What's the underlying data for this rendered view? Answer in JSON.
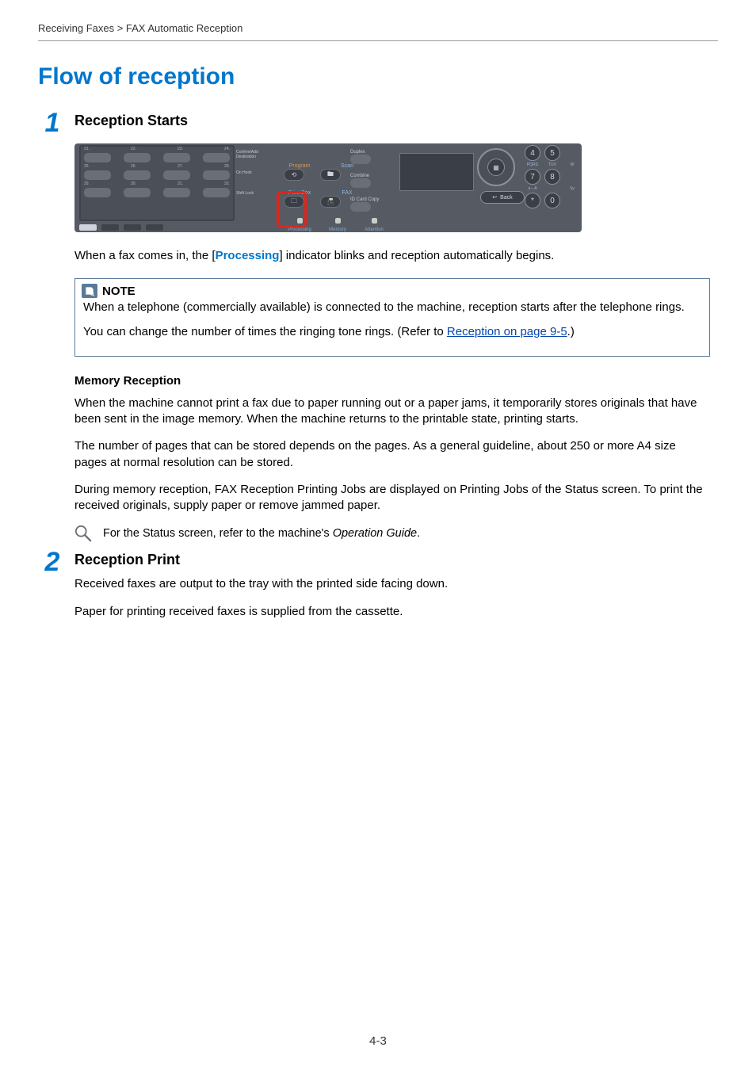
{
  "breadcrumb": "Receiving Faxes > FAX Automatic Reception",
  "heading": "Flow of reception",
  "step1": {
    "num": "1",
    "title": "Reception Starts",
    "intro_pre": "When a fax comes in, the [",
    "intro_proc": "Processing",
    "intro_post": "] indicator blinks and reception automatically begins.",
    "note_label": "NOTE",
    "note_p1": "When a telephone (commercially available) is connected to the machine, reception starts after the telephone rings.",
    "note_p2_pre": "You can change the number of times the ringing tone rings. (Refer to ",
    "note_p2_link": "Reception on page 9-5",
    "note_p2_post": ".)",
    "mem_heading": "Memory Reception",
    "mem_p1": "When the machine cannot print a fax due to paper running out or a paper jams, it temporarily stores originals that have been sent in the image memory. When the machine returns to the printable state, printing starts.",
    "mem_p2": "The number of pages that can be stored depends on the pages. As a general guideline, about 250 or more A4 size pages at normal resolution can be stored.",
    "mem_p3": "During memory reception, FAX Reception Printing Jobs are displayed on Printing Jobs of the Status screen. To print the received originals, supply paper or remove jammed paper.",
    "ref_pre": "For the Status screen, refer to the machine's ",
    "ref_ital": "Operation Guide",
    "ref_post": "."
  },
  "step2": {
    "num": "2",
    "title": "Reception Print",
    "p1": "Received faxes are output to the tray with the printed side facing down.",
    "p2": "Paper for printing received faxes is supplied from the cassette."
  },
  "panel": {
    "keys_row1": [
      "21.",
      "22.",
      "23.",
      "24."
    ],
    "keys_row2": [
      "25.",
      "26.",
      "27.",
      "28."
    ],
    "keys_row3": [
      "29.",
      "30.",
      "31.",
      "32."
    ],
    "side_labels": [
      "Confirm/Add Destination",
      "",
      "On Hook",
      "Shift Lock"
    ],
    "mid_top": [
      "Program",
      "Scan"
    ],
    "mid_bot": [
      "Print Box",
      "FAX"
    ],
    "indicators": [
      "Processing",
      "Memory",
      "Attention"
    ],
    "right_labels": [
      "Duplex",
      "Combine",
      "ID Card Copy"
    ],
    "back": "Back",
    "numpad": [
      [
        "4",
        "5"
      ],
      [
        "7",
        "8"
      ],
      [
        "*",
        "0"
      ]
    ],
    "numlbl": [
      [
        "PQRS",
        "TUV",
        "W"
      ],
      [
        "a⇔A",
        "",
        "Sy"
      ]
    ]
  },
  "page_number": "4-3"
}
